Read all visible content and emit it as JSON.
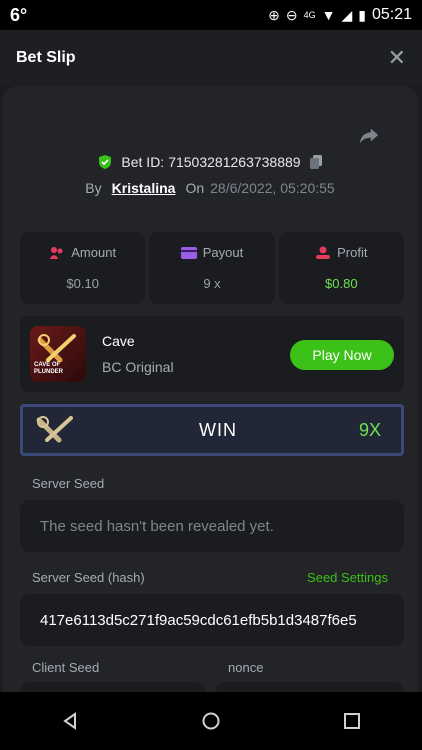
{
  "status_bar": {
    "left": "6°",
    "network": "4G",
    "time": "05:21"
  },
  "header": {
    "title": "Bet Slip",
    "close_glyph": "✕"
  },
  "bet": {
    "id_label": "Bet ID:",
    "id_value": "71503281263738889",
    "by_label": "By",
    "user": "Kristalina",
    "on_label": "On",
    "datetime": "28/6/2022, 05:20:55"
  },
  "stats": [
    {
      "label": "Amount",
      "value": "$0.10",
      "icon": "amount-icon"
    },
    {
      "label": "Payout",
      "value": "9 x",
      "icon": "card-icon"
    },
    {
      "label": "Profit",
      "value": "$0.80",
      "icon": "profit-icon"
    }
  ],
  "game": {
    "name": "Cave",
    "subtitle": "BC Original",
    "thumb_text_1": "CAVE OF",
    "thumb_text_2": "PLUNDER",
    "play_label": "Play Now"
  },
  "result": {
    "label": "WIN",
    "multiplier": "9X"
  },
  "server_seed": {
    "label": "Server Seed",
    "placeholder": "The seed hasn't been revealed yet."
  },
  "server_seed_hash": {
    "label": "Server Seed (hash)",
    "settings_label": "Seed Settings",
    "value": "417e6113d5c271f9ac59cdc61efb5b1d3487f6e5"
  },
  "client_seed": {
    "label": "Client Seed"
  },
  "nonce": {
    "label": "nonce"
  },
  "colors": {
    "accent_green": "#3bc117",
    "win_green": "#6ee056",
    "background": "#141517"
  }
}
